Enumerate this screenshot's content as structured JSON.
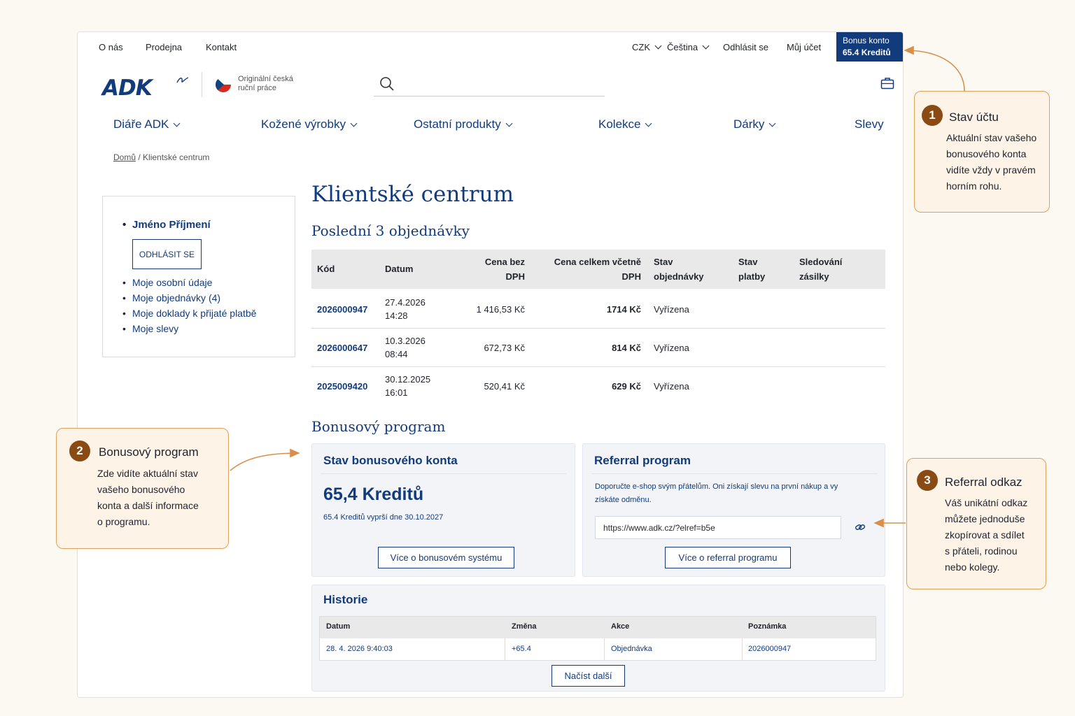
{
  "topnav": {
    "about": "O nás",
    "store": "Prodejna",
    "contact": "Kontakt",
    "currency": "CZK",
    "language": "Čeština",
    "logout": "Odhlásit se",
    "account": "Můj účet"
  },
  "bonus_account": {
    "label": "Bonus konto",
    "value": "65.4 Kreditů"
  },
  "brand": {
    "logo_text": "ADK",
    "tagline": "Originální česká ruční práce"
  },
  "icons": {
    "search": "search-icon",
    "bag": "bag-icon",
    "link": "link-icon",
    "chevron": "chevron-down-icon"
  },
  "mainnav": {
    "item1": "Diáře ADK",
    "item2": "Kožené výrobky",
    "item3": "Ostatní produkty",
    "item4": "Kolekce",
    "item5": "Dárky",
    "item6": "Slevy"
  },
  "breadcrumb": {
    "home": "Domů",
    "sep": " / ",
    "current": "Klientské centrum"
  },
  "sidebar": {
    "name": "Jméno Příjmení",
    "logout_btn": "ODHLÁSIT SE",
    "links": [
      "Moje osobní údaje",
      "Moje objednávky (4)",
      "Moje doklady k přijaté platbě",
      "Moje slevy"
    ]
  },
  "page_title": "Klientské centrum",
  "orders": {
    "heading": "Poslední 3 objednávky",
    "columns": {
      "code": "Kód",
      "date": "Datum",
      "price_net_1": "Cena bez",
      "price_net_2": "DPH",
      "price_total_1": "Cena celkem včetně",
      "price_total_2": "DPH",
      "status_1": "Stav",
      "status_2": "objednávky",
      "payment_1": "Stav",
      "payment_2": "platby",
      "tracking_1": "Sledování",
      "tracking_2": "zásilky"
    },
    "rows": [
      {
        "code": "2026000947",
        "date": "27.4.2026",
        "time": "14:28",
        "net": "1 416,53 Kč",
        "total": "1714 Kč",
        "status": "Vyřízena"
      },
      {
        "code": "2026000647",
        "date": "10.3.2026",
        "time": "08:44",
        "net": "672,73 Kč",
        "total": "814 Kč",
        "status": "Vyřízena"
      },
      {
        "code": "2025009420",
        "date": "30.12.2025",
        "time": "16:01",
        "net": "520,41 Kč",
        "total": "629 Kč",
        "status": "Vyřízena"
      }
    ]
  },
  "bonus_program": {
    "heading": "Bonusový program",
    "account_card": {
      "title": "Stav bonusového konta",
      "credits": "65,4 Kreditů",
      "expiry": "65.4 Kreditů vyprší dne 30.10.2027",
      "button": "Více o bonusovém systému"
    },
    "referral_card": {
      "title": "Referral program",
      "text_line1": "Doporučte e-shop svým přátelům. Oni získají slevu na první nákup a vy",
      "text_line2": "získáte odměnu.",
      "link_value": "https://www.adk.cz/?elref=b5e",
      "button": "Více o referral programu"
    },
    "history": {
      "title": "Historie",
      "columns": {
        "date": "Datum",
        "change": "Změna",
        "action": "Akce",
        "note": "Poznámka"
      },
      "rows": [
        {
          "date": "28. 4. 2026 9:40:03",
          "change": "+65.4",
          "action": "Objednávka",
          "note": "2026000947"
        }
      ],
      "load_more": "Načíst další"
    }
  },
  "callouts": [
    {
      "number": "1",
      "title": "Stav účtu",
      "lines": [
        "Aktuální stav vašeho",
        "bonusového konta",
        "vidíte vždy v pravém",
        "horním rohu."
      ]
    },
    {
      "number": "2",
      "title": "Bonusový program",
      "lines": [
        "Zde vidíte aktuální stav",
        "vašeho bonusového",
        "konta a další informace",
        "o programu."
      ]
    },
    {
      "number": "3",
      "title": "Referral odkaz",
      "lines": [
        "Váš unikátní odkaz",
        "můžete jednoduše",
        "zkopírovat a sdílet",
        "s přáteli, rodinou",
        "nebo kolegy."
      ]
    }
  ],
  "colors": {
    "brand_blue": "#123b7c",
    "callout_bg": "#fdf3e6",
    "callout_border": "#e0a05d",
    "callout_number": "#8a4a14",
    "arrow": "#d98f4a"
  }
}
